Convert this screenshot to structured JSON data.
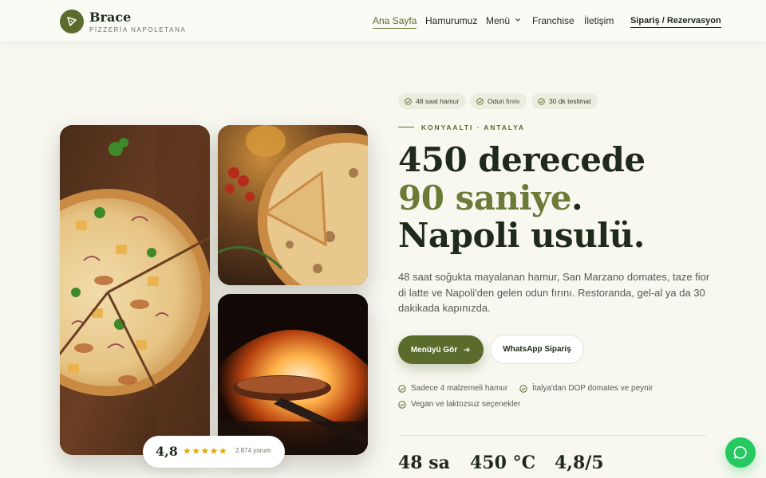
{
  "brand": {
    "name": "Brace",
    "tagline": "PİZZERİA NAPOLETANA"
  },
  "nav": {
    "items": [
      {
        "label": "Ana Sayfa",
        "active": true
      },
      {
        "label": "Hamurumuz"
      },
      {
        "label": "Menü",
        "dropdown": true
      },
      {
        "label": "Franchise"
      },
      {
        "label": "İletişim"
      }
    ],
    "cta": "Sipariş / Rezervasyon"
  },
  "rating": {
    "value": "4,8",
    "stars": "★★★★★",
    "reviews": "2.874 yorum"
  },
  "hero": {
    "pills": [
      "48 saat hamur",
      "Odun fırını",
      "30 dk teslimat"
    ],
    "eyebrow": "KONYAALTI · ANTALYA",
    "headline": {
      "line1": "450 derecede",
      "line2_accent": "90 saniye",
      "line2_end": ".",
      "line3": "Napoli usulü."
    },
    "lead": "48 saat soğukta mayalanan hamur, San Marzano domates, taze fior di latte ve Napoli'den gelen odun fırını. Restoranda, gel-al ya da 30 dakikada kapınızda.",
    "primary_cta": "Menüyü Gör",
    "secondary_cta": "WhatsApp Sipariş",
    "features": [
      "Sadece 4 malzemeli hamur",
      "İtalya'dan DOP domates ve peynir",
      "Vegan ve laktozsuz seçenekler"
    ],
    "stats": [
      "48 sa",
      "450 °C",
      "4,8/5"
    ]
  },
  "colors": {
    "accent": "#5b6b2c",
    "accent_text": "#6e7a38",
    "star": "#e2a614",
    "whatsapp": "#25c861"
  },
  "icons": {
    "logo": "pizza-slice-icon",
    "check": "check-circle-icon",
    "arrow": "arrow-right-icon",
    "chevron": "chevron-down-icon",
    "chat": "whatsapp-chat-icon"
  }
}
